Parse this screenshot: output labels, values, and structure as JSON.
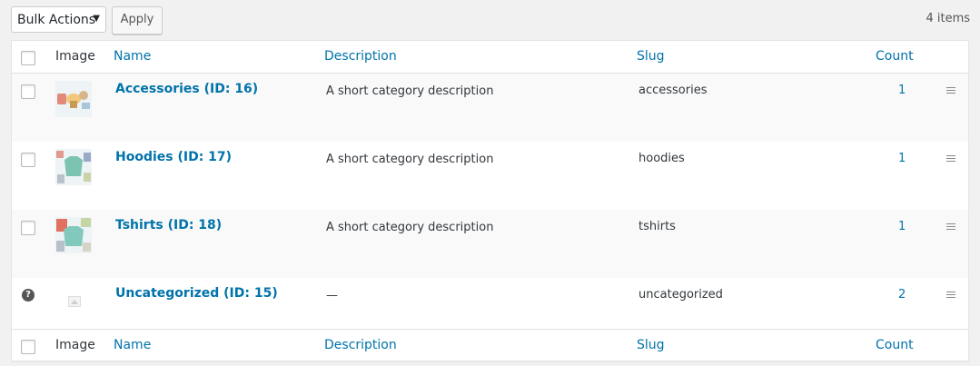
{
  "toolbar": {
    "bulk_actions_label": "Bulk Actions",
    "apply_label": "Apply",
    "items_count": "4 items"
  },
  "table": {
    "headers": {
      "image": "Image",
      "name": "Name",
      "description": "Description",
      "slug": "Slug",
      "count": "Count"
    },
    "rows": [
      {
        "name": "Accessories (ID: 16)",
        "description": "A short category description",
        "slug": "accessories",
        "count": "1",
        "thumb_icon": "accessories-thumbnail"
      },
      {
        "name": "Hoodies (ID: 17)",
        "description": "A short category description",
        "slug": "hoodies",
        "count": "1",
        "thumb_icon": "hoodies-thumbnail"
      },
      {
        "name": "Tshirts (ID: 18)",
        "description": "A short category description",
        "slug": "tshirts",
        "count": "1",
        "thumb_icon": "tshirts-thumbnail"
      },
      {
        "name": "Uncategorized (ID: 15)",
        "description": "—",
        "slug": "uncategorized",
        "count": "2",
        "thumb_icon": "placeholder-image-icon",
        "help_icon": "?"
      }
    ]
  },
  "colors": {
    "link": "#0073aa",
    "text": "#32373c",
    "page_bg": "#f1f1f1",
    "row_alt": "#f9f9f9"
  }
}
